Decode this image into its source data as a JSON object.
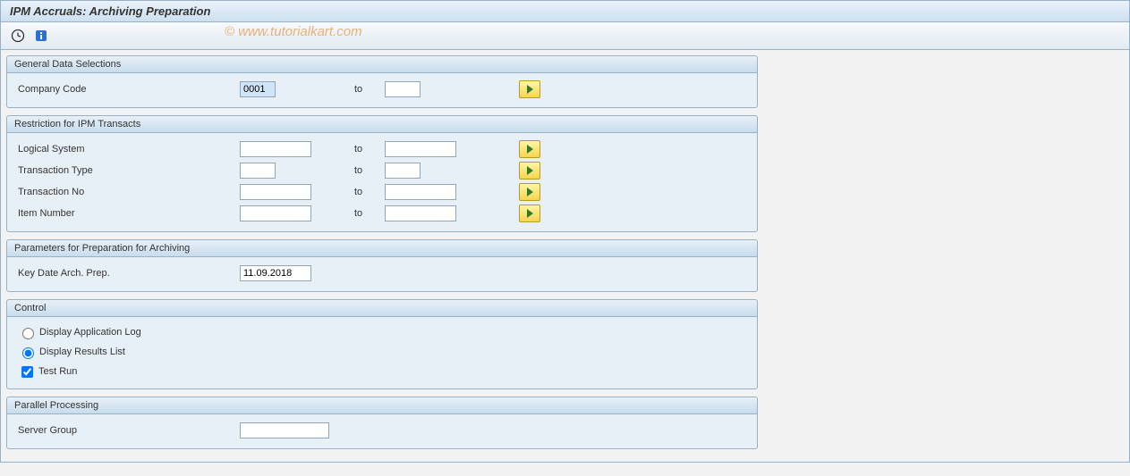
{
  "title": "IPM Accruals: Archiving Preparation",
  "watermark": "© www.tutorialkart.com",
  "sections": {
    "general": {
      "header": "General Data Selections",
      "company_code": {
        "label": "Company Code",
        "from": "0001",
        "to_label": "to",
        "to": ""
      }
    },
    "restriction": {
      "header": "Restriction for IPM Transacts",
      "logical_system": {
        "label": "Logical System",
        "from": "",
        "to_label": "to",
        "to": ""
      },
      "transaction_type": {
        "label": "Transaction Type",
        "from": "",
        "to_label": "to",
        "to": ""
      },
      "transaction_no": {
        "label": "Transaction No",
        "from": "",
        "to_label": "to",
        "to": ""
      },
      "item_number": {
        "label": "Item Number",
        "from": "",
        "to_label": "to",
        "to": ""
      }
    },
    "params": {
      "header": "Parameters for Preparation for Archiving",
      "key_date": {
        "label": "Key Date Arch. Prep.",
        "value": "11.09.2018"
      }
    },
    "control": {
      "header": "Control",
      "display_app_log": "Display Application Log",
      "display_results": "Display Results List",
      "test_run": "Test Run",
      "selected_radio": "display_results",
      "test_run_checked": true
    },
    "parallel": {
      "header": "Parallel Processing",
      "server_group": {
        "label": "Server Group",
        "value": ""
      }
    }
  }
}
